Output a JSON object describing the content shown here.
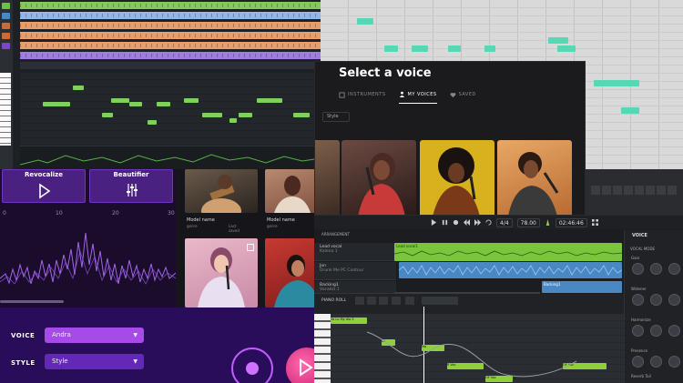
{
  "voice_dialog": {
    "title": "Select a voice",
    "tabs": [
      {
        "label": "INSTRUMENTS",
        "icon": "instrument-icon"
      },
      {
        "label": "MY VOICES",
        "icon": "person-icon"
      },
      {
        "label": "SAVED",
        "icon": "heart-icon"
      }
    ],
    "active_tab": "MY VOICES",
    "style_dropdown": "Style"
  },
  "revocalize": {
    "revocalize_label": "Revocalize",
    "beautifier_label": "Beautifier",
    "axis": [
      "0",
      "10",
      "20",
      "30"
    ]
  },
  "models": [
    {
      "name": "Model name",
      "sub": "genre",
      "sub2": "Last saved"
    },
    {
      "name": "Model name",
      "sub": "genre",
      "sub2": ""
    }
  ],
  "controls": {
    "voice_label": "VOICE",
    "voice_value": "Andra",
    "style_label": "STYLE",
    "style_value": "Style"
  },
  "arrangement": {
    "header": "ARRANGEMENT",
    "meter": "4/4",
    "tempo": "78.00",
    "time": "02:46:46",
    "tracks": [
      {
        "name": "Lead vocal",
        "sub": "Kalena 1"
      },
      {
        "name": "Jon",
        "sub": "Drunk Me PC Contour"
      },
      {
        "name": "Backing1",
        "sub": "Vocalist 1"
      }
    ],
    "clip_labels": [
      "Lead vocal1",
      "Backing1"
    ],
    "piano_roll_label": "PIANO ROLL",
    "note_labels": [
      "Vo Lu My dia 3",
      "Di",
      "Ma",
      "fl Voc",
      "OF Voc",
      "OF Voc"
    ],
    "right_panel_title": "VOICE",
    "right_panel_section": "VOCAL MODE",
    "knob_sections": [
      "Gain",
      "Widener",
      "Harmonize",
      "Presence",
      "Reverb Tail"
    ],
    "knob_labels": [
      "Pitch",
      "Formant",
      "Tone",
      "Width"
    ]
  },
  "colors": {
    "accent_green": "#7fd05c",
    "teal_note": "#56d8b5",
    "purple": "#7a35d6",
    "clip_blue": "#4a88c4",
    "clip_lime": "#7bc53c"
  }
}
